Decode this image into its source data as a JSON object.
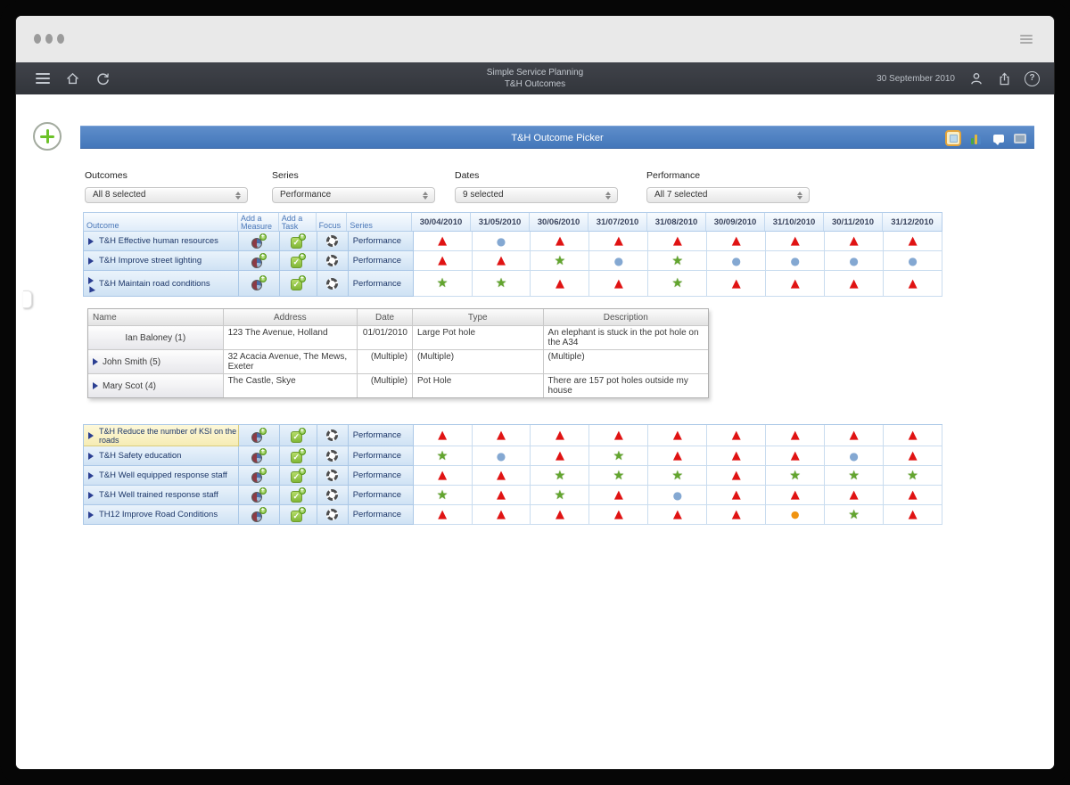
{
  "icons": {
    "check": "✓",
    "plus": "+",
    "help": "?",
    "tri": "▲",
    "star": "★",
    "cir": "●",
    "org": "●"
  },
  "navbar": {
    "title_line1": "Simple Service Planning",
    "title_line2": "T&H Outcomes",
    "date": "30 September 2010"
  },
  "picker": {
    "title": "T&H Outcome Picker"
  },
  "filters": [
    {
      "label": "Outcomes",
      "value": "All 8 selected"
    },
    {
      "label": "Series",
      "value": "Performance"
    },
    {
      "label": "Dates",
      "value": "9 selected"
    },
    {
      "label": "Performance",
      "value": "All 7 selected"
    }
  ],
  "table": {
    "headers": {
      "outcome": "Outcome",
      "add_measure": "Add a Measure",
      "add_task": "Add a Task",
      "focus": "Focus",
      "series": "Series"
    },
    "dates": [
      "30/04/2010",
      "31/05/2010",
      "30/06/2010",
      "31/07/2010",
      "31/08/2010",
      "30/09/2010",
      "31/10/2010",
      "30/11/2010",
      "31/12/2010"
    ],
    "rows": [
      {
        "label": "T&H Effective human resources",
        "series": "Performance",
        "highlight": false,
        "expanded": false,
        "indicators": [
          "tri",
          "cir",
          "tri",
          "tri",
          "tri",
          "tri",
          "tri",
          "tri",
          "tri"
        ]
      },
      {
        "label": "T&H Improve street lighting",
        "series": "Performance",
        "highlight": false,
        "expanded": false,
        "indicators": [
          "tri",
          "tri",
          "star",
          "cir",
          "star",
          "cir",
          "cir",
          "cir",
          "cir"
        ]
      },
      {
        "label": "T&H Maintain road conditions",
        "series": "Performance",
        "highlight": false,
        "expanded": true,
        "indicators": [
          "star",
          "star",
          "tri",
          "tri",
          "star",
          "tri",
          "tri",
          "tri",
          "tri"
        ]
      },
      {
        "label": "T&H Reduce the number of KSI on the roads",
        "series": "Performance",
        "highlight": true,
        "expanded": false,
        "indicators": [
          "tri",
          "tri",
          "tri",
          "tri",
          "tri",
          "tri",
          "tri",
          "tri",
          "tri"
        ]
      },
      {
        "label": "T&H Safety education",
        "series": "Performance",
        "highlight": false,
        "expanded": false,
        "indicators": [
          "star",
          "cir",
          "tri",
          "star",
          "tri",
          "tri",
          "tri",
          "cir",
          "tri"
        ]
      },
      {
        "label": "T&H Well equipped response staff",
        "series": "Performance",
        "highlight": false,
        "expanded": false,
        "indicators": [
          "tri",
          "tri",
          "star",
          "star",
          "star",
          "tri",
          "star",
          "star",
          "star"
        ]
      },
      {
        "label": "T&H Well trained response staff",
        "series": "Performance",
        "highlight": false,
        "expanded": false,
        "indicators": [
          "star",
          "tri",
          "star",
          "tri",
          "cir",
          "tri",
          "tri",
          "tri",
          "tri"
        ]
      },
      {
        "label": "TH12 Improve Road Conditions",
        "series": "Performance",
        "highlight": false,
        "expanded": false,
        "indicators": [
          "tri",
          "tri",
          "tri",
          "tri",
          "tri",
          "tri",
          "org",
          "star",
          "tri"
        ]
      }
    ]
  },
  "subtable": {
    "headers": [
      "Name",
      "Address",
      "Date",
      "Type",
      "Description"
    ],
    "rows": [
      {
        "name": "Ian Baloney (1)",
        "expandable": false,
        "address": "123 The Avenue, Holland",
        "date": "01/01/2010",
        "type": "Large Pot hole",
        "description": "An elephant is stuck in the pot hole on the A34"
      },
      {
        "name": "John Smith (5)",
        "expandable": true,
        "address": "32 Acacia Avenue, The Mews, Exeter",
        "date": "(Multiple)",
        "type": "(Multiple)",
        "description": "(Multiple)"
      },
      {
        "name": "Mary Scot (4)",
        "expandable": true,
        "address": "The Castle, Skye",
        "date": "(Multiple)",
        "type": "Pot Hole",
        "description": "There are 157 pot holes outside my house"
      }
    ]
  },
  "colors": {
    "accent_blue": "#4b7ec1",
    "indicator_red": "#e01313",
    "indicator_green": "#62a52e",
    "indicator_blue": "#84a8d2",
    "indicator_orange": "#f0930f",
    "highlight_yellow": "#f6ecb4"
  }
}
